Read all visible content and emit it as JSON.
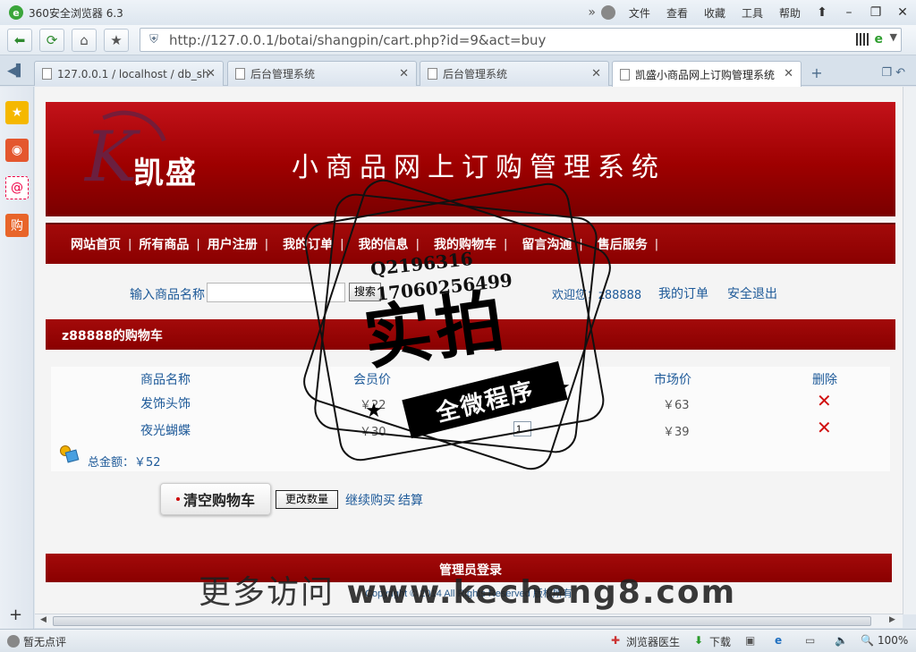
{
  "browser": {
    "title": "360安全浏览器 6.3",
    "menu": [
      "文件",
      "查看",
      "收藏",
      "工具",
      "帮助"
    ],
    "url": "http://127.0.0.1/botai/shangpin/cart.php?id=9&act=buy",
    "tabs": [
      {
        "label": "127.0.0.1 / localhost / db_sh"
      },
      {
        "label": "后台管理系统"
      },
      {
        "label": "后台管理系统"
      },
      {
        "label": "凯盛小商品网上订购管理系统"
      }
    ],
    "status": {
      "left": "暂无点评",
      "doctor": "浏览器医生",
      "download": "下载",
      "zoom": "100%"
    }
  },
  "site": {
    "logo_name": "凯盛",
    "title": "小商品网上订购管理系统",
    "nav": [
      "网站首页",
      "所有商品",
      "用户注册",
      "我的订单",
      "我的信息",
      "我的购物车",
      "留言沟通",
      "售后服务"
    ],
    "search": {
      "label": "输入商品名称",
      "button": "搜索",
      "value": ""
    },
    "welcome": "欢迎您：z88888",
    "my_orders": "我的订单",
    "logout": "安全退出"
  },
  "cart": {
    "title": "z88888的购物车",
    "headers": [
      "商品名称",
      "会员价",
      "数量",
      "市场价",
      "删除"
    ],
    "rows": [
      {
        "name": "发饰头饰",
        "member_price": "￥22",
        "qty": "",
        "market_price": "￥63"
      },
      {
        "name": "夜光蝴蝶",
        "member_price": "￥30",
        "qty": "1",
        "market_price": "￥39"
      }
    ],
    "total_label": "总金额：￥52",
    "clear_button": "清空购物车",
    "update_button": "更改数量",
    "continue_link": "继续购买",
    "checkout_link": "结算"
  },
  "footer": {
    "admin_login": "管理员登录",
    "copyright": "Copyright © 2014 All Rights Reserved 版权所有"
  },
  "watermark": {
    "phone1": "Q2196316",
    "phone2": "17060256499",
    "big": "实拍",
    "ribbon": "全微程序",
    "bottom_prefix": "更多访问 ",
    "bottom_site": "www.kecheng8.com"
  },
  "colors": {
    "brand_red": "#9e0000",
    "link_blue": "#1e5a99",
    "delete_red": "#d01010"
  }
}
